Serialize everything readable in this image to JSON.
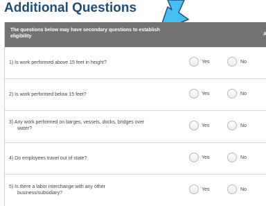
{
  "page": {
    "title": "Additional Questions"
  },
  "panel": {
    "header_text": "The questions below may have secondary questions to establish eligibility",
    "header_right": "A"
  },
  "options": {
    "yes": "Yes",
    "no": "No"
  },
  "questions": [
    {
      "line1": "1) Is work performed above 15 feet in height?",
      "line2": ""
    },
    {
      "line1": "2) Is work performed below 15 feet?",
      "line2": ""
    },
    {
      "line1": "3) Any work performed on barges, vessels, docks, bridges over",
      "line2": "water?"
    },
    {
      "line1": "4) Do employees travel out of state?",
      "line2": ""
    },
    {
      "line1": "5) Is there a labor interchange with any other",
      "line2": "business/subsidiary?"
    }
  ],
  "annotation": {
    "arrow_color": "#44bff2",
    "icon": "arrow-down-icon"
  }
}
